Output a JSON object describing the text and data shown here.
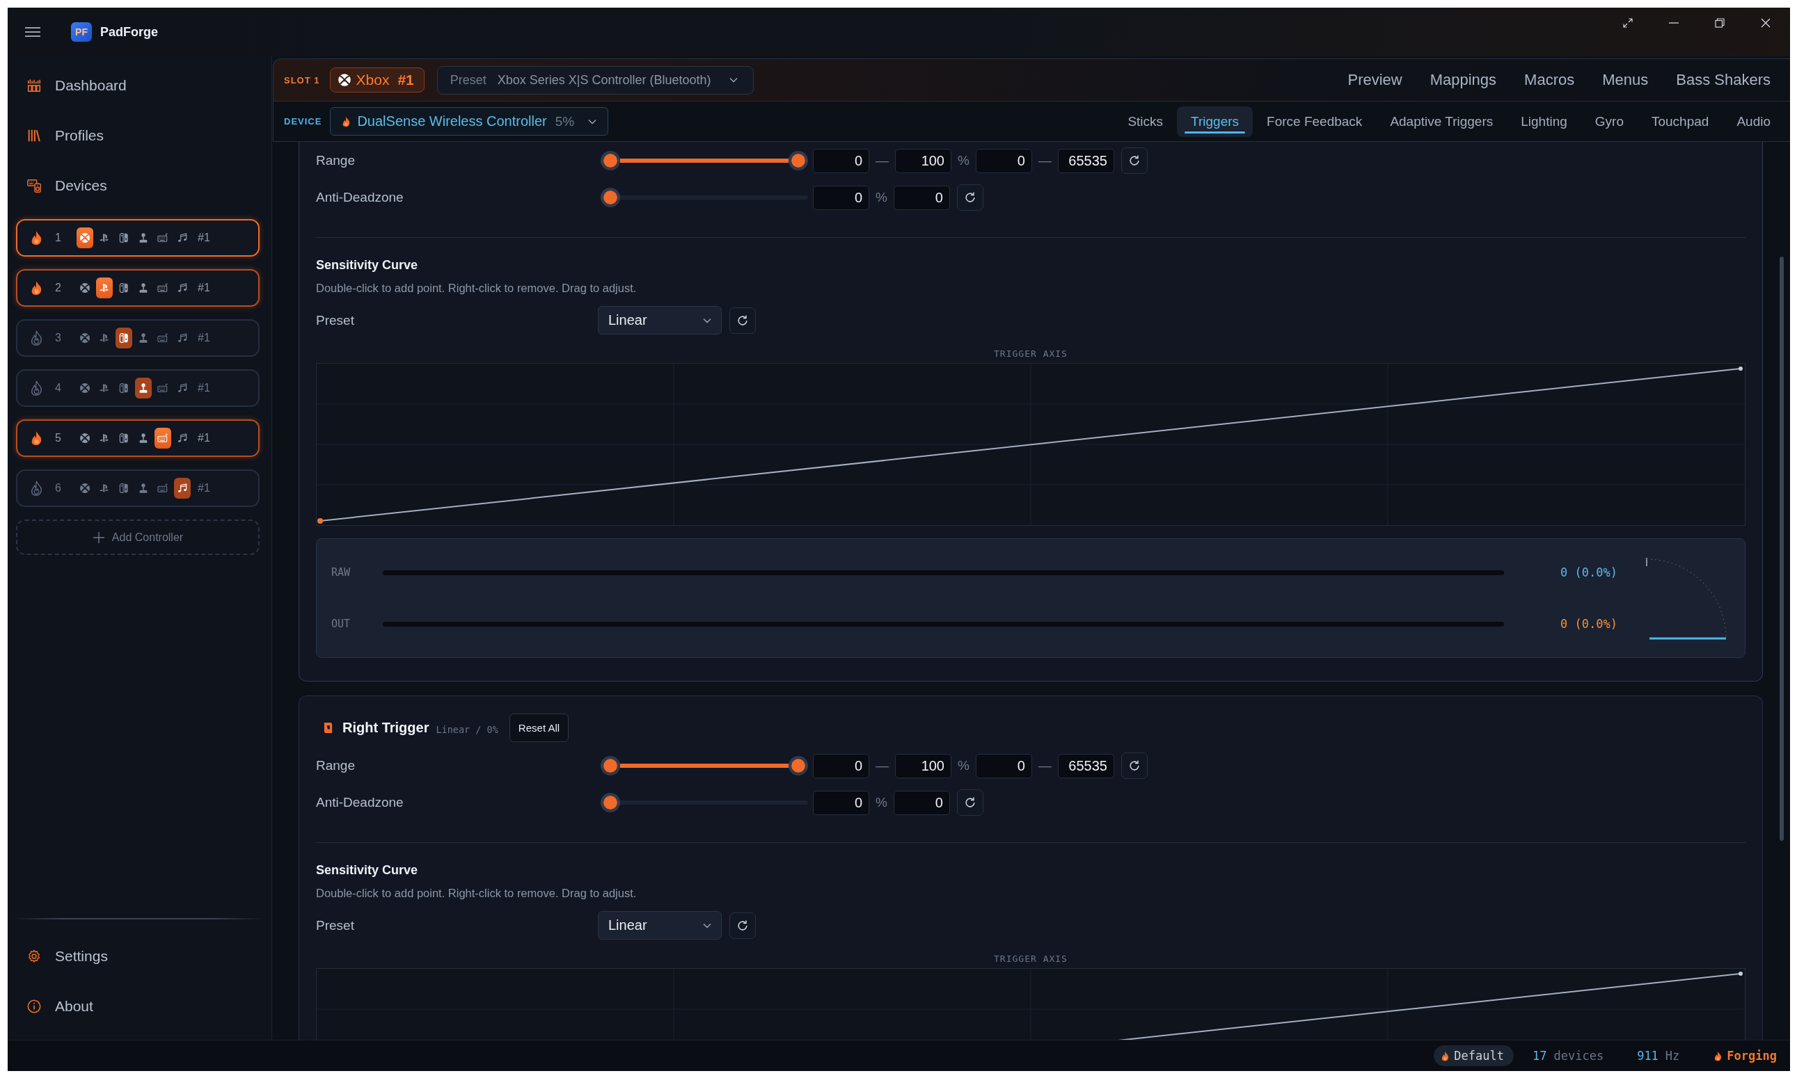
{
  "title_bar": {
    "logo_text": "PF",
    "app_name": "PadForge"
  },
  "sidebar": {
    "nav": [
      {
        "kind": "dashboard",
        "label": "Dashboard",
        "selected": false
      },
      {
        "kind": "profiles",
        "label": "Profiles",
        "selected": false
      },
      {
        "kind": "devices",
        "label": "Devices",
        "selected": false
      }
    ],
    "slots": [
      {
        "number": "1",
        "tag": "#1",
        "selected": true,
        "active": true,
        "types": [
          {
            "kind": "xbox",
            "selected": true
          },
          {
            "kind": "playstation",
            "selected": false
          },
          {
            "kind": "switch",
            "selected": false
          },
          {
            "kind": "joystick",
            "selected": false
          },
          {
            "kind": "keyboard",
            "selected": false
          },
          {
            "kind": "midi",
            "selected": false
          }
        ]
      },
      {
        "number": "2",
        "tag": "#1",
        "selected": false,
        "active": true,
        "types": [
          {
            "kind": "xbox",
            "selected": false
          },
          {
            "kind": "playstation",
            "selected": true
          },
          {
            "kind": "switch",
            "selected": false
          },
          {
            "kind": "joystick",
            "selected": false
          },
          {
            "kind": "keyboard",
            "selected": false
          },
          {
            "kind": "midi",
            "selected": false
          }
        ]
      },
      {
        "number": "3",
        "tag": "#1",
        "selected": false,
        "active": false,
        "types": [
          {
            "kind": "xbox",
            "selected": false
          },
          {
            "kind": "playstation",
            "selected": false
          },
          {
            "kind": "switch",
            "selected": true
          },
          {
            "kind": "joystick",
            "selected": false
          },
          {
            "kind": "keyboard",
            "selected": false
          },
          {
            "kind": "midi",
            "selected": false
          }
        ]
      },
      {
        "number": "4",
        "tag": "#1",
        "selected": false,
        "active": false,
        "types": [
          {
            "kind": "xbox",
            "selected": false
          },
          {
            "kind": "playstation",
            "selected": false
          },
          {
            "kind": "switch",
            "selected": false
          },
          {
            "kind": "joystick",
            "selected": true
          },
          {
            "kind": "keyboard",
            "selected": false
          },
          {
            "kind": "midi",
            "selected": false
          }
        ]
      },
      {
        "number": "5",
        "tag": "#1",
        "selected": false,
        "active": true,
        "types": [
          {
            "kind": "xbox",
            "selected": false
          },
          {
            "kind": "playstation",
            "selected": false
          },
          {
            "kind": "switch",
            "selected": false
          },
          {
            "kind": "joystick",
            "selected": false
          },
          {
            "kind": "keyboard",
            "selected": true
          },
          {
            "kind": "midi",
            "selected": false
          }
        ]
      },
      {
        "number": "6",
        "tag": "#1",
        "selected": false,
        "active": false,
        "types": [
          {
            "kind": "xbox",
            "selected": false
          },
          {
            "kind": "playstation",
            "selected": false
          },
          {
            "kind": "switch",
            "selected": false
          },
          {
            "kind": "joystick",
            "selected": false
          },
          {
            "kind": "keyboard",
            "selected": false
          },
          {
            "kind": "midi",
            "selected": true
          }
        ]
      }
    ],
    "add_controller": "Add Controller",
    "footer_nav": [
      {
        "kind": "settings",
        "label": "Settings",
        "selected": false
      },
      {
        "kind": "about",
        "label": "About",
        "selected": false
      }
    ]
  },
  "header": {
    "slot_label": "SLOT 1",
    "slot_badge": {
      "kind": "xbox",
      "name": "Xbox",
      "tag": "#1"
    },
    "preset": {
      "label": "Preset",
      "value": "Xbox Series X|S Controller (Bluetooth)"
    },
    "tabs": [
      {
        "label": "Preview",
        "selected": false
      },
      {
        "label": "Mappings",
        "selected": false
      },
      {
        "label": "Macros",
        "selected": false
      },
      {
        "label": "Menus",
        "selected": false
      },
      {
        "label": "Bass Shakers",
        "selected": false
      }
    ],
    "device_label": "DEVICE",
    "device": {
      "name": "DualSense Wireless Controller",
      "battery": "5%"
    },
    "subtabs": [
      {
        "label": "Sticks",
        "selected": false
      },
      {
        "label": "Triggers",
        "selected": true
      },
      {
        "label": "Force Feedback",
        "selected": false
      },
      {
        "label": "Adaptive Triggers",
        "selected": false
      },
      {
        "label": "Lighting",
        "selected": false
      },
      {
        "label": "Gyro",
        "selected": false
      },
      {
        "label": "Touchpad",
        "selected": false
      },
      {
        "label": "Audio",
        "selected": false
      }
    ]
  },
  "sections": [
    {
      "rows": [
        {
          "kind": "range",
          "label": "Range",
          "start": {
            "level": 0
          },
          "end": {
            "level": 1
          },
          "fields": [
            {
              "value": "0",
              "suffix": "—"
            },
            {
              "value": "100",
              "suffix": "%"
            },
            {
              "value": "0",
              "suffix": "—"
            },
            {
              "value": "65535"
            }
          ]
        },
        {
          "kind": "single",
          "label": "Anti-Deadzone",
          "level": 0,
          "fields": [
            {
              "value": "0",
              "suffix": "%"
            },
            {
              "value": "0"
            }
          ]
        }
      ],
      "curve": {
        "title": "Sensitivity Curve",
        "hint": "Double-click to add point. Right-click to remove. Drag to adjust.",
        "preset_label": "Preset",
        "preset_value": "Linear",
        "axis_label": "TRIGGER AXIS"
      },
      "monitor": [
        {
          "kind": "raw",
          "label": "RAW",
          "reading": "0 (0.0%)"
        },
        {
          "kind": "out",
          "label": "OUT",
          "reading": "0 (0.0%)"
        }
      ]
    },
    {
      "title": "Right Trigger",
      "summary": "Linear / 0%",
      "reset_label": "Reset All",
      "rows": [
        {
          "kind": "range",
          "label": "Range",
          "start": {
            "level": 0
          },
          "end": {
            "level": 1
          },
          "fields": [
            {
              "value": "0",
              "suffix": "—"
            },
            {
              "value": "100",
              "suffix": "%"
            },
            {
              "value": "0",
              "suffix": "—"
            },
            {
              "value": "65535"
            }
          ]
        },
        {
          "kind": "single",
          "label": "Anti-Deadzone",
          "level": 0,
          "fields": [
            {
              "value": "0",
              "suffix": "%"
            },
            {
              "value": "0"
            }
          ]
        }
      ],
      "curve": {
        "title": "Sensitivity Curve",
        "hint": "Double-click to add point. Right-click to remove. Drag to adjust.",
        "preset_label": "Preset",
        "preset_value": "Linear",
        "axis_label": "TRIGGER AXIS"
      }
    }
  ],
  "status_bar": {
    "profile": "Default",
    "devices": {
      "value": "17",
      "unit": "devices"
    },
    "rate": {
      "value": "911",
      "unit": "Hz"
    },
    "engine": "Forging"
  }
}
